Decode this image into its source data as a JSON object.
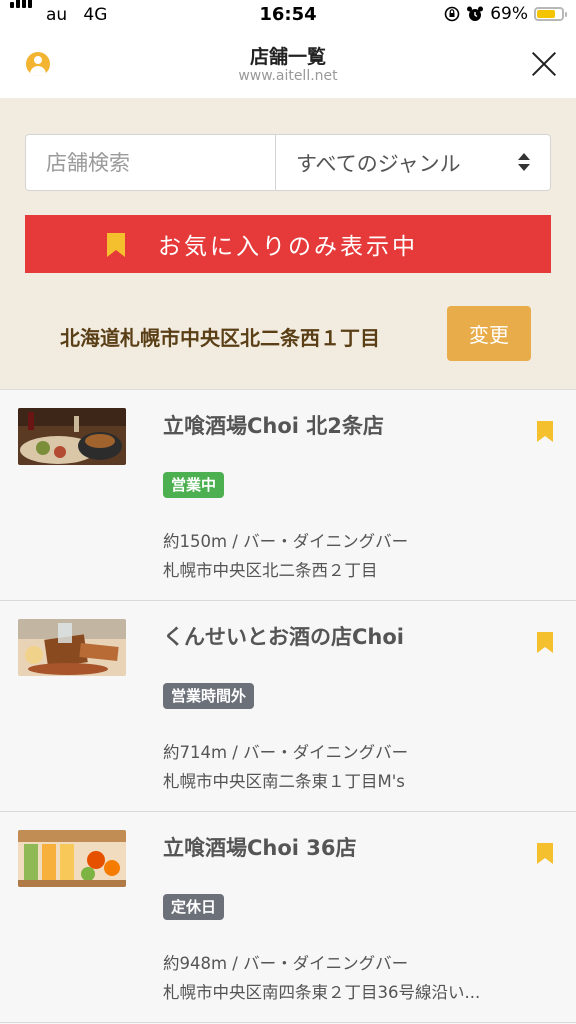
{
  "status_bar": {
    "carrier": "au",
    "network": "4G",
    "time": "16:54",
    "battery": "69%",
    "battery_level": 0.69
  },
  "nav": {
    "title": "店舗一覧",
    "url": "www.aitell.net"
  },
  "filters": {
    "search_placeholder": "店舗検索",
    "genre_selected": "すべてのジャンル",
    "favorites_label": "お気に入りのみ表示中",
    "location": "北海道札幌市中央区北二条西１丁目",
    "change_label": "変更"
  },
  "stores": [
    {
      "name": "立喰酒場Choi 北2条店",
      "status": "営業中",
      "status_type": "open",
      "distance_genre": "約150m / バー・ダイニングバー",
      "address": "札幌市中央区北二条西２丁目"
    },
    {
      "name": "くんせいとお酒の店Choi",
      "status": "営業時間外",
      "status_type": "closed",
      "distance_genre": "約714m / バー・ダイニングバー",
      "address": "札幌市中央区南二条東１丁目M's"
    },
    {
      "name": "立喰酒場Choi 36店",
      "status": "定休日",
      "status_type": "holiday",
      "distance_genre": "約948m / バー・ダイニングバー",
      "address": "札幌市中央区南四条東２丁目36号線沿い..."
    }
  ],
  "colors": {
    "accent_red": "#e63a3a",
    "bookmark_yellow": "#f5c02e",
    "open_green": "#4caf50",
    "closed_gray": "#6b7079",
    "change_button": "#e8ad4a",
    "header_beige": "#f2ece0"
  }
}
